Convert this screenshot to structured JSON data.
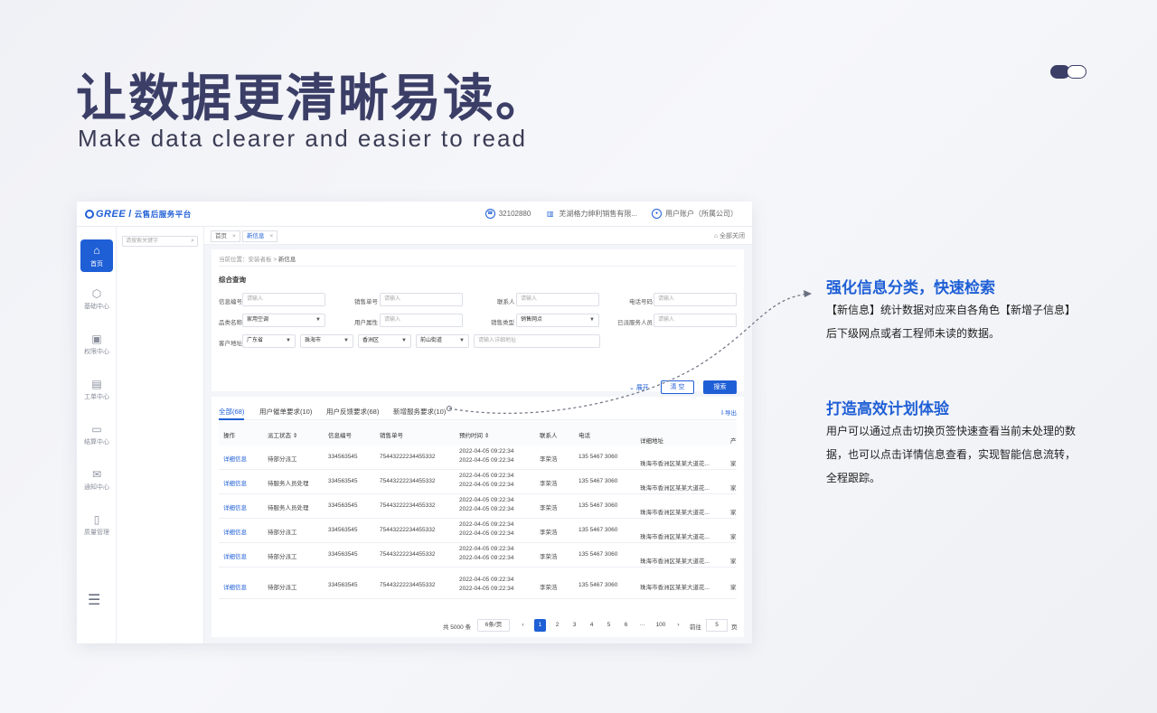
{
  "hero": {
    "title": "让数据更清晰易读。",
    "subtitle": "Make data clearer and easier to read"
  },
  "app": {
    "logo": "GREE",
    "logo_sep": "/",
    "platform_name": "云售后服务平台",
    "topbar": {
      "account_no": "32102880",
      "company": "芜湖格力绅利销售有限...",
      "user": "用户账户（所属公司）"
    },
    "nav": [
      {
        "label": "首页",
        "icon": "home-icon"
      },
      {
        "label": "基础中心",
        "icon": "cube-icon"
      },
      {
        "label": "权限中心",
        "icon": "user-card-icon"
      },
      {
        "label": "工单中心",
        "icon": "clipboard-icon"
      },
      {
        "label": "结算中心",
        "icon": "wallet-icon"
      },
      {
        "label": "通知中心",
        "icon": "mail-icon"
      },
      {
        "label": "质量管理",
        "icon": "document-icon"
      }
    ],
    "search_placeholder": "请搜索关键字",
    "page_tabs": [
      "首页",
      "新信息"
    ],
    "close_all": "全部关闭",
    "breadcrumb": {
      "prefix": "当前位置：",
      "parent": "安装者板",
      "sep": ">",
      "current": "新信息"
    },
    "query": {
      "title": "综合查询",
      "fields": {
        "info_no": {
          "label": "信息编号",
          "placeholder": "请输入"
        },
        "sales_no": {
          "label": "销售单号",
          "placeholder": "请输入"
        },
        "contact": {
          "label": "联系人",
          "placeholder": "请输入"
        },
        "phone": {
          "label": "电话号码",
          "placeholder": "请输入"
        },
        "category": {
          "label": "品类名称",
          "value": "家用空调"
        },
        "user_attr": {
          "label": "用户属性",
          "placeholder": "请输入"
        },
        "sales_type": {
          "label": "销售类型",
          "value": "销售网点"
        },
        "dispatched": {
          "label": "已派服务人员",
          "placeholder": "请输入"
        },
        "address": {
          "label": "客户地址",
          "province": "广东省",
          "city": "珠海市",
          "district": "香洲区",
          "street": "前山街道",
          "detail_placeholder": "请输入详细地址"
        }
      },
      "expand": "展开",
      "clear": "清 空",
      "search": "搜索"
    },
    "list_tabs": [
      "全部(68)",
      "用户催单要求(10)",
      "用户反馈要求(68)",
      "新增服务要求(10)"
    ],
    "export": "导出",
    "table": {
      "columns": [
        "操作",
        "派工状态",
        "信息编号",
        "销售单号",
        "预约时间",
        "联系人",
        "电话",
        "详细地址",
        "产"
      ],
      "rows": [
        {
          "action": "详细信息",
          "status": "待部分派工",
          "info_no": "334563545",
          "sales_no": "75443222234455332",
          "time1": "2022-04-05 09:22:34",
          "time2": "2022-04-05 09:22:34",
          "contact": "李荣浩",
          "phone": "135 5467 3060",
          "address": "珠海市香洲区某某大道花...",
          "extra": "家"
        },
        {
          "action": "详细信息",
          "status": "待服务人员处理",
          "info_no": "334563545",
          "sales_no": "75443222234455332",
          "time1": "2022-04-05 09:22:34",
          "time2": "2022-04-05 09:22:34",
          "contact": "李荣浩",
          "phone": "135 5467 3060",
          "address": "珠海市香洲区某某大道花...",
          "extra": "家"
        },
        {
          "action": "详细信息",
          "status": "待服务人员处理",
          "info_no": "334563545",
          "sales_no": "75443222234455332",
          "time1": "2022-04-05 09:22:34",
          "time2": "2022-04-05 09:22:34",
          "contact": "李荣浩",
          "phone": "135 5467 3060",
          "address": "珠海市香洲区某某大道花...",
          "extra": "家"
        },
        {
          "action": "详细信息",
          "status": "待部分派工",
          "info_no": "334563545",
          "sales_no": "75443222234455332",
          "time1": "2022-04-05 09:22:34",
          "time2": "2022-04-05 09:22:34",
          "contact": "李荣浩",
          "phone": "135 5467 3060",
          "address": "珠海市香洲区某某大道花...",
          "extra": "家"
        },
        {
          "action": "详细信息",
          "status": "待部分派工",
          "info_no": "334563545",
          "sales_no": "75443222234455332",
          "time1": "2022-04-05 09:22:34",
          "time2": "2022-04-05 09:22:34",
          "contact": "李荣浩",
          "phone": "135 5467 3060",
          "address": "珠海市香洲区某某大道花...",
          "extra": "家"
        },
        {
          "action": "详细信息",
          "status": "待部分派工",
          "info_no": "334563545",
          "sales_no": "75443222234455332",
          "time1": "2022-04-05 09:22:34",
          "time2": "2022-04-05 09:22:34",
          "contact": "李荣浩",
          "phone": "135 5467 3060",
          "address": "珠海市香洲区某某大道花...",
          "extra": "家"
        }
      ]
    },
    "pagination": {
      "total": "共 5000 条",
      "page_size": "6条/页",
      "prev": "‹",
      "pages": [
        "1",
        "2",
        "3",
        "4",
        "5",
        "6",
        "···",
        "100"
      ],
      "current": "1",
      "next": "›",
      "goto": "前往",
      "goto_value": "5",
      "page_unit": "页"
    }
  },
  "callouts": [
    {
      "title": "强化信息分类，快速检索",
      "body": "【新信息】统计数据对应来自各角色【新增子信息】后下级网点或者工程师未读的数据。"
    },
    {
      "title": "打造高效计划体验",
      "body": "用户可以通过点击切换页签快速查看当前未处理的数据，也可以点击详情信息查看，实现智能信息流转，全程跟踪。"
    }
  ],
  "colors": {
    "primary": "#1f5fd6",
    "hero_text": "#3b3e66",
    "background": "#f3f4f8"
  }
}
